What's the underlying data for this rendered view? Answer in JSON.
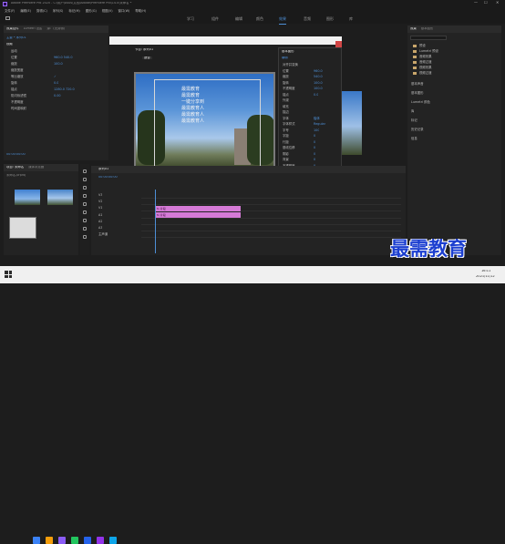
{
  "window": {
    "title": "Adobe Premiere Pro 2020 - C:\\用户\\Asus\\文档\\Adobe\\Premiere Pro\\14.0\\未命名 *",
    "menu": [
      "文件(F)",
      "编辑(E)",
      "剪辑(C)",
      "序列(S)",
      "标记(M)",
      "图形(G)",
      "视图(V)",
      "窗口(W)",
      "帮助(H)"
    ]
  },
  "workspaces": [
    "学习",
    "组件",
    "编辑",
    "颜色",
    "效果",
    "音频",
    "图形",
    "库"
  ],
  "active_workspace": "效果",
  "source_panel": {
    "tabs": [
      "效果控件",
      "Lumetri 范围",
      "源：(无剪辑)",
      "音频剪辑混合器：序列01"
    ],
    "clip_label": "主要 * 序列01",
    "section": "视频",
    "rows": [
      {
        "label": "运动",
        "value": ""
      },
      {
        "label": "位置",
        "value": "960.0  540.0"
      },
      {
        "label": "缩放",
        "value": "100.0"
      },
      {
        "label": "缩放宽度",
        "value": ""
      },
      {
        "label": "等比缩放",
        "value": "✓"
      },
      {
        "label": "旋转",
        "value": "0.0"
      },
      {
        "label": "锚点",
        "value": "1280.0  720.0"
      },
      {
        "label": "防闪烁滤镜",
        "value": "0.00"
      },
      {
        "label": "不透明度",
        "value": ""
      },
      {
        "label": "时间重映射",
        "value": ""
      }
    ],
    "timecode": "00:00:00:00"
  },
  "project_panel": {
    "tabs": [
      "项目: 未命名",
      "媒体浏览器"
    ],
    "file": "未命名.prproj",
    "thumb_label": "",
    "thumbs": [
      "",
      "",
      ""
    ]
  },
  "program_panel": {
    "title": "节目: 序列01",
    "fit": "适合",
    "text_overlay": [
      "最需教育",
      "最需教育",
      "一键分享到",
      "最需教育人",
      "最需教育人",
      "最需教育人"
    ]
  },
  "essential_graphics": {
    "title": "基本图形",
    "tab_label": "编辑",
    "rows": [
      {
        "label": "对齐并变换",
        "value": ""
      },
      {
        "label": "位置",
        "value": "960.0"
      },
      {
        "label": "缩放",
        "value": "540.0"
      },
      {
        "label": "旋转",
        "value": "100.0"
      },
      {
        "label": "不透明度",
        "value": "100.0"
      },
      {
        "label": "锚点",
        "value": "0.0"
      },
      {
        "label": "外观",
        "value": ""
      },
      {
        "label": "填充",
        "value": ""
      },
      {
        "label": "描边",
        "value": ""
      },
      {
        "label": "字体",
        "value": "楷体"
      },
      {
        "label": "字体样式",
        "value": "Regular"
      },
      {
        "label": "字号",
        "value": "100"
      },
      {
        "label": "字距",
        "value": "0"
      },
      {
        "label": "行距",
        "value": "0"
      },
      {
        "label": "基线位移",
        "value": "0"
      },
      {
        "label": "阴影",
        "value": "0"
      },
      {
        "label": "背景",
        "value": "0"
      },
      {
        "label": "不透明度",
        "value": "0"
      },
      {
        "label": "大小",
        "value": "0"
      },
      {
        "label": "角度",
        "value": "0"
      },
      {
        "label": "距离",
        "value": "0"
      },
      {
        "label": "模糊",
        "value": "0"
      },
      {
        "label": "对齐方式",
        "value": ""
      },
      {
        "label": "自动",
        "value": "无"
      }
    ],
    "color": "#ffffff"
  },
  "right_panel": {
    "tabs": [
      "效果",
      "基本图形"
    ],
    "search": "",
    "tree": [
      "预设",
      "Lumetri 预设",
      "音频效果",
      "音频过渡",
      "视频效果",
      "视频过渡"
    ],
    "tree_colors": [
      "#c9a66b",
      "#c9a66b",
      "#c9a66b",
      "#c9a66b",
      "#c9a66b",
      "#c9a66b"
    ],
    "side_items": [
      "基本声音",
      "基本图形",
      "Lumetri 颜色",
      "库",
      "标记",
      "历史记录",
      "信息"
    ]
  },
  "text_styles": {
    "label": "Aa",
    "count": 10
  },
  "timeline": {
    "title": "序列01",
    "timecode": "00:00:00:00",
    "tracks": [
      "V3",
      "V2",
      "V1",
      "A1",
      "A2",
      "A3",
      "主声道"
    ],
    "clip_v2": "fx 片段",
    "clip_v1": "fx 片段"
  },
  "watermark": "最需教育",
  "taskbar": {
    "time": "16:11",
    "date": "2021/11/12",
    "icons": [
      "#3b82f6",
      "#f59e0b",
      "#8b5cf6",
      "#22c55e",
      "#2563eb",
      "#9333ea",
      "#0ea5e9"
    ]
  }
}
